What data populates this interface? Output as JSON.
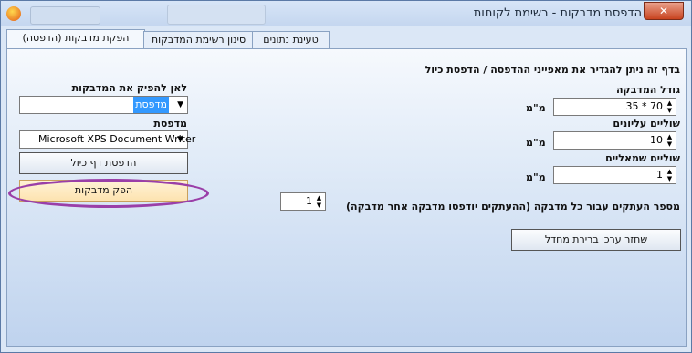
{
  "window": {
    "title": "הדפסת מדבקות - רשימת לקוחות",
    "close_symbol": "✕"
  },
  "tabs": [
    {
      "label": "הפקת מדבקות (הדפסה)",
      "active": true
    },
    {
      "label": "סינון רשימת המדבקות",
      "active": false
    },
    {
      "label": "טעינת נתונים",
      "active": false
    }
  ],
  "panel": {
    "intro": "בדף זה ניתן להגדיר את מאפייני ההדפסה / הדפסת כיול",
    "label_size": {
      "label": "גודל המדבקה",
      "value": "35 * 70",
      "unit": "מ\"מ"
    },
    "top_margin": {
      "label": "שוליים עליונים",
      "value": "10",
      "unit": "מ\"מ"
    },
    "left_margin": {
      "label": "שוליים שמאליים",
      "value": "1",
      "unit": "מ\"מ"
    },
    "copies": {
      "label": "מספר העתקים עבור כל מדבקה (ההעתקים יודפסו מדבקה אחר מדבקה)",
      "value": "1"
    },
    "output_target": {
      "label": "לאן להפיק את המדבקות",
      "value": "מדפסת"
    },
    "printer": {
      "label": "מדפסת",
      "value": "Microsoft XPS Document Writer"
    },
    "print_calibration_button": "הדפסת דף כיול",
    "produce_labels_button": "הפק מדבקות",
    "restore_defaults_button": "שחזר ערכי ברירת מחדל"
  },
  "colors": {
    "highlight_ellipse": "#9a3fa8",
    "selection": "#3399ff"
  }
}
